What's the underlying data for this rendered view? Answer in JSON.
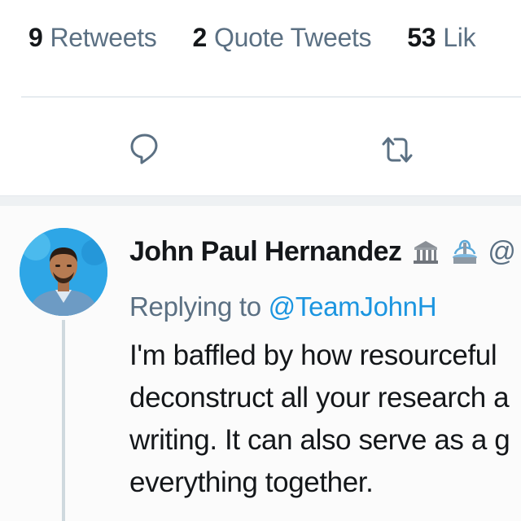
{
  "stats": {
    "retweets": {
      "count": "9",
      "label": "Retweets"
    },
    "quote_tweets": {
      "count": "2",
      "label": "Quote Tweets"
    },
    "likes": {
      "count": "53",
      "label": "Lik"
    }
  },
  "actions": {
    "reply_icon": "reply-icon",
    "retweet_icon": "retweet-icon"
  },
  "reply": {
    "author_name": "John Paul Hernandez",
    "badges": [
      "classical-building-emoji",
      "fountain-emoji"
    ],
    "handle_peek": "@",
    "replying_prefix": "Replying to",
    "replying_handle": "@TeamJohnH",
    "body_lines": [
      "I'm baffled by how resourceful",
      "deconstruct all your research a",
      "writing. It can also serve as a g",
      "everything together."
    ]
  },
  "colors": {
    "primary_text": "#14171a",
    "secondary_text": "#5b7083",
    "link": "#1b95e0",
    "divider": "#e6ecf0"
  }
}
